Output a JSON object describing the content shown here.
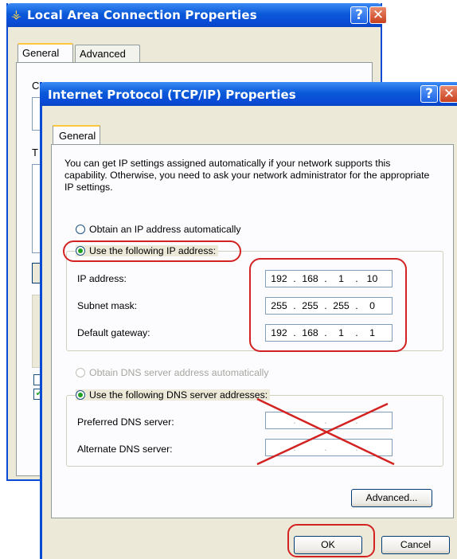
{
  "back_window": {
    "title": "Local Area Connection Properties",
    "title_icon": "network-icon",
    "help_glyph": "?",
    "close_glyph": "✕",
    "tabs": [
      {
        "label": "General",
        "selected": true
      },
      {
        "label": "Advanced",
        "selected": false
      }
    ],
    "fragment_c": "C",
    "fragment_t": "T"
  },
  "dialog": {
    "title": "Internet Protocol (TCP/IP) Properties",
    "help_glyph": "?",
    "close_glyph": "✕",
    "tab_label": "General",
    "description": "You can get IP settings assigned automatically if your network supports this capability. Otherwise, you need to ask your network administrator for the appropriate IP settings.",
    "ip_auto_label": "Obtain an IP address automatically",
    "ip_manual_label": "Use the following IP address:",
    "ip_mode": "manual",
    "fields": {
      "ip_address": {
        "label": "IP address:",
        "octets": [
          "192",
          "168",
          "1",
          "10"
        ]
      },
      "subnet_mask": {
        "label": "Subnet mask:",
        "octets": [
          "255",
          "255",
          "255",
          "0"
        ]
      },
      "default_gateway": {
        "label": "Default gateway:",
        "octets": [
          "192",
          "168",
          "1",
          "1"
        ]
      }
    },
    "dns_auto_label": "Obtain DNS server address automatically",
    "dns_manual_label": "Use the following DNS server addresses:",
    "dns_mode": "manual",
    "dns_fields": {
      "preferred": {
        "label": "Preferred DNS server:",
        "octets": [
          "",
          "",
          "",
          ""
        ]
      },
      "alternate": {
        "label": "Alternate DNS server:",
        "octets": [
          "",
          "",
          "",
          ""
        ]
      }
    },
    "advanced_button": "Advanced...",
    "ok_button": "OK",
    "cancel_button": "Cancel"
  },
  "colors": {
    "titlebar": "#0a4bd6",
    "annotation": "#d22222",
    "radio_selected": "#21a121"
  }
}
